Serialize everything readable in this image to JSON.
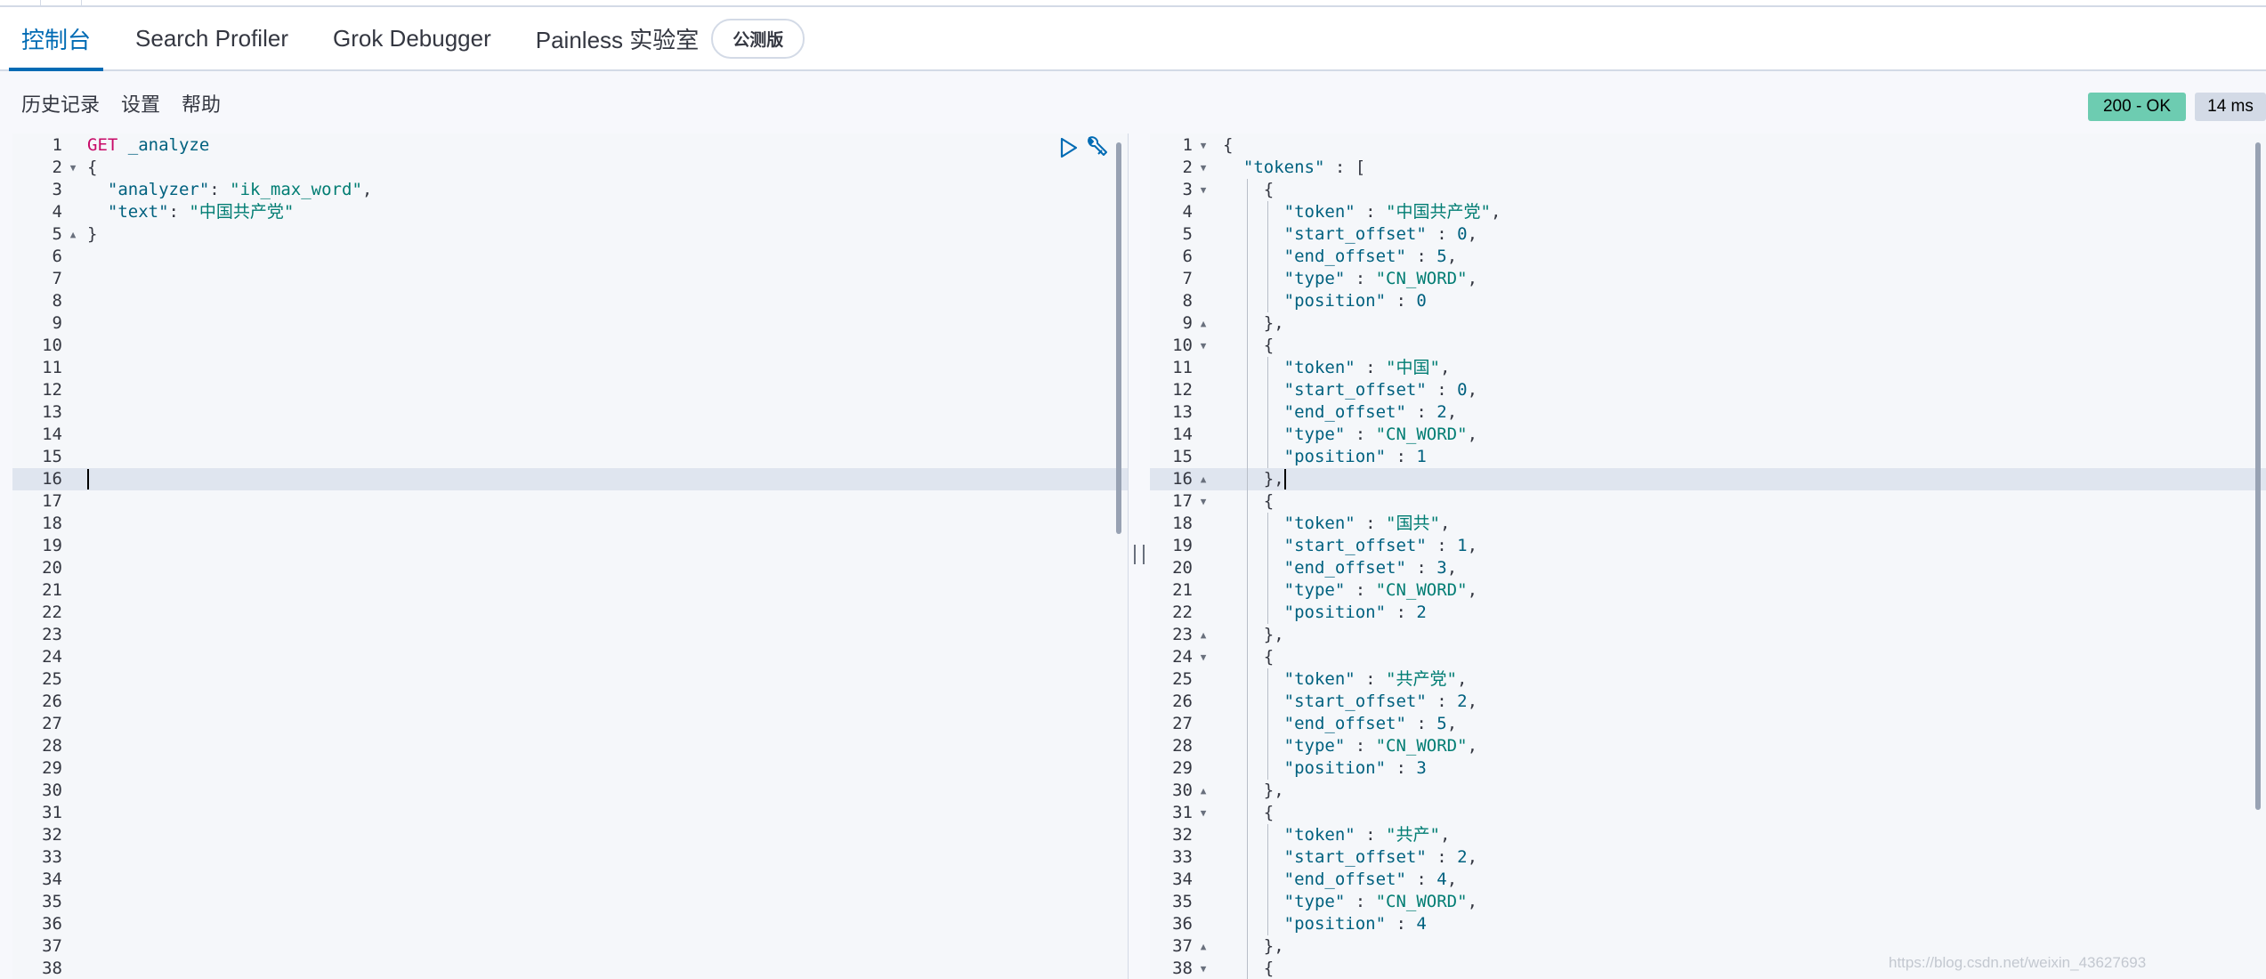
{
  "tabs": [
    {
      "label": "控制台",
      "active": true
    },
    {
      "label": "Search Profiler",
      "active": false
    },
    {
      "label": "Grok Debugger",
      "active": false
    },
    {
      "label": "Painless 实验室",
      "active": false
    }
  ],
  "beta_badge": "公测版",
  "toolbar": {
    "history": "历史记录",
    "settings": "设置",
    "help": "帮助"
  },
  "status": {
    "code": "200 - OK",
    "time": "14 ms"
  },
  "request_editor": {
    "line_count": 38,
    "cursor_line": 16,
    "lines": [
      [
        [
          "method",
          "GET"
        ],
        [
          "punc",
          " "
        ],
        [
          "url",
          "_analyze"
        ]
      ],
      [
        [
          "punc",
          "{"
        ]
      ],
      [
        [
          "punc",
          "  "
        ],
        [
          "key",
          "\"analyzer\""
        ],
        [
          "punc",
          ": "
        ],
        [
          "str",
          "\"ik_max_word\""
        ],
        [
          "punc",
          ","
        ]
      ],
      [
        [
          "punc",
          "  "
        ],
        [
          "key",
          "\"text\""
        ],
        [
          "punc",
          ": "
        ],
        [
          "str",
          "\"中国共产党\""
        ]
      ],
      [
        [
          "punc",
          "}"
        ]
      ]
    ],
    "folds": {
      "2": "down",
      "5": "up"
    }
  },
  "response_editor": {
    "line_count": 38,
    "cursor_line": 16,
    "lines": [
      [
        [
          "punc",
          "{"
        ]
      ],
      [
        [
          "punc",
          "  "
        ],
        [
          "key",
          "\"tokens\""
        ],
        [
          "punc",
          " : ["
        ]
      ],
      [
        [
          "punc",
          "    {"
        ]
      ],
      [
        [
          "punc",
          "      "
        ],
        [
          "key",
          "\"token\""
        ],
        [
          "punc",
          " : "
        ],
        [
          "str",
          "\"中国共产党\""
        ],
        [
          "punc",
          ","
        ]
      ],
      [
        [
          "punc",
          "      "
        ],
        [
          "key",
          "\"start_offset\""
        ],
        [
          "punc",
          " : "
        ],
        [
          "num",
          "0"
        ],
        [
          "punc",
          ","
        ]
      ],
      [
        [
          "punc",
          "      "
        ],
        [
          "key",
          "\"end_offset\""
        ],
        [
          "punc",
          " : "
        ],
        [
          "num",
          "5"
        ],
        [
          "punc",
          ","
        ]
      ],
      [
        [
          "punc",
          "      "
        ],
        [
          "key",
          "\"type\""
        ],
        [
          "punc",
          " : "
        ],
        [
          "str",
          "\"CN_WORD\""
        ],
        [
          "punc",
          ","
        ]
      ],
      [
        [
          "punc",
          "      "
        ],
        [
          "key",
          "\"position\""
        ],
        [
          "punc",
          " : "
        ],
        [
          "num",
          "0"
        ]
      ],
      [
        [
          "punc",
          "    },"
        ]
      ],
      [
        [
          "punc",
          "    {"
        ]
      ],
      [
        [
          "punc",
          "      "
        ],
        [
          "key",
          "\"token\""
        ],
        [
          "punc",
          " : "
        ],
        [
          "str",
          "\"中国\""
        ],
        [
          "punc",
          ","
        ]
      ],
      [
        [
          "punc",
          "      "
        ],
        [
          "key",
          "\"start_offset\""
        ],
        [
          "punc",
          " : "
        ],
        [
          "num",
          "0"
        ],
        [
          "punc",
          ","
        ]
      ],
      [
        [
          "punc",
          "      "
        ],
        [
          "key",
          "\"end_offset\""
        ],
        [
          "punc",
          " : "
        ],
        [
          "num",
          "2"
        ],
        [
          "punc",
          ","
        ]
      ],
      [
        [
          "punc",
          "      "
        ],
        [
          "key",
          "\"type\""
        ],
        [
          "punc",
          " : "
        ],
        [
          "str",
          "\"CN_WORD\""
        ],
        [
          "punc",
          ","
        ]
      ],
      [
        [
          "punc",
          "      "
        ],
        [
          "key",
          "\"position\""
        ],
        [
          "punc",
          " : "
        ],
        [
          "num",
          "1"
        ]
      ],
      [
        [
          "punc",
          "    },"
        ]
      ],
      [
        [
          "punc",
          "    {"
        ]
      ],
      [
        [
          "punc",
          "      "
        ],
        [
          "key",
          "\"token\""
        ],
        [
          "punc",
          " : "
        ],
        [
          "str",
          "\"国共\""
        ],
        [
          "punc",
          ","
        ]
      ],
      [
        [
          "punc",
          "      "
        ],
        [
          "key",
          "\"start_offset\""
        ],
        [
          "punc",
          " : "
        ],
        [
          "num",
          "1"
        ],
        [
          "punc",
          ","
        ]
      ],
      [
        [
          "punc",
          "      "
        ],
        [
          "key",
          "\"end_offset\""
        ],
        [
          "punc",
          " : "
        ],
        [
          "num",
          "3"
        ],
        [
          "punc",
          ","
        ]
      ],
      [
        [
          "punc",
          "      "
        ],
        [
          "key",
          "\"type\""
        ],
        [
          "punc",
          " : "
        ],
        [
          "str",
          "\"CN_WORD\""
        ],
        [
          "punc",
          ","
        ]
      ],
      [
        [
          "punc",
          "      "
        ],
        [
          "key",
          "\"position\""
        ],
        [
          "punc",
          " : "
        ],
        [
          "num",
          "2"
        ]
      ],
      [
        [
          "punc",
          "    },"
        ]
      ],
      [
        [
          "punc",
          "    {"
        ]
      ],
      [
        [
          "punc",
          "      "
        ],
        [
          "key",
          "\"token\""
        ],
        [
          "punc",
          " : "
        ],
        [
          "str",
          "\"共产党\""
        ],
        [
          "punc",
          ","
        ]
      ],
      [
        [
          "punc",
          "      "
        ],
        [
          "key",
          "\"start_offset\""
        ],
        [
          "punc",
          " : "
        ],
        [
          "num",
          "2"
        ],
        [
          "punc",
          ","
        ]
      ],
      [
        [
          "punc",
          "      "
        ],
        [
          "key",
          "\"end_offset\""
        ],
        [
          "punc",
          " : "
        ],
        [
          "num",
          "5"
        ],
        [
          "punc",
          ","
        ]
      ],
      [
        [
          "punc",
          "      "
        ],
        [
          "key",
          "\"type\""
        ],
        [
          "punc",
          " : "
        ],
        [
          "str",
          "\"CN_WORD\""
        ],
        [
          "punc",
          ","
        ]
      ],
      [
        [
          "punc",
          "      "
        ],
        [
          "key",
          "\"position\""
        ],
        [
          "punc",
          " : "
        ],
        [
          "num",
          "3"
        ]
      ],
      [
        [
          "punc",
          "    },"
        ]
      ],
      [
        [
          "punc",
          "    {"
        ]
      ],
      [
        [
          "punc",
          "      "
        ],
        [
          "key",
          "\"token\""
        ],
        [
          "punc",
          " : "
        ],
        [
          "str",
          "\"共产\""
        ],
        [
          "punc",
          ","
        ]
      ],
      [
        [
          "punc",
          "      "
        ],
        [
          "key",
          "\"start_offset\""
        ],
        [
          "punc",
          " : "
        ],
        [
          "num",
          "2"
        ],
        [
          "punc",
          ","
        ]
      ],
      [
        [
          "punc",
          "      "
        ],
        [
          "key",
          "\"end_offset\""
        ],
        [
          "punc",
          " : "
        ],
        [
          "num",
          "4"
        ],
        [
          "punc",
          ","
        ]
      ],
      [
        [
          "punc",
          "      "
        ],
        [
          "key",
          "\"type\""
        ],
        [
          "punc",
          " : "
        ],
        [
          "str",
          "\"CN_WORD\""
        ],
        [
          "punc",
          ","
        ]
      ],
      [
        [
          "punc",
          "      "
        ],
        [
          "key",
          "\"position\""
        ],
        [
          "punc",
          " : "
        ],
        [
          "num",
          "4"
        ]
      ],
      [
        [
          "punc",
          "    },"
        ]
      ],
      [
        [
          "punc",
          "    {"
        ]
      ]
    ],
    "folds": {
      "1": "down",
      "2": "down",
      "3": "down",
      "9": "up",
      "10": "down",
      "16": "up",
      "17": "down",
      "23": "up",
      "24": "down",
      "30": "up",
      "31": "down",
      "37": "up",
      "38": "down"
    }
  },
  "icons": {
    "run": "play-icon",
    "wrench": "wrench-icon"
  },
  "colors": {
    "accent": "#006bb4",
    "status_ok": "#6dccb1",
    "method": "#c80a68",
    "string": "#017d73",
    "key": "#00617f"
  },
  "watermark": "https://blog.csdn.net/weixin_43627693"
}
